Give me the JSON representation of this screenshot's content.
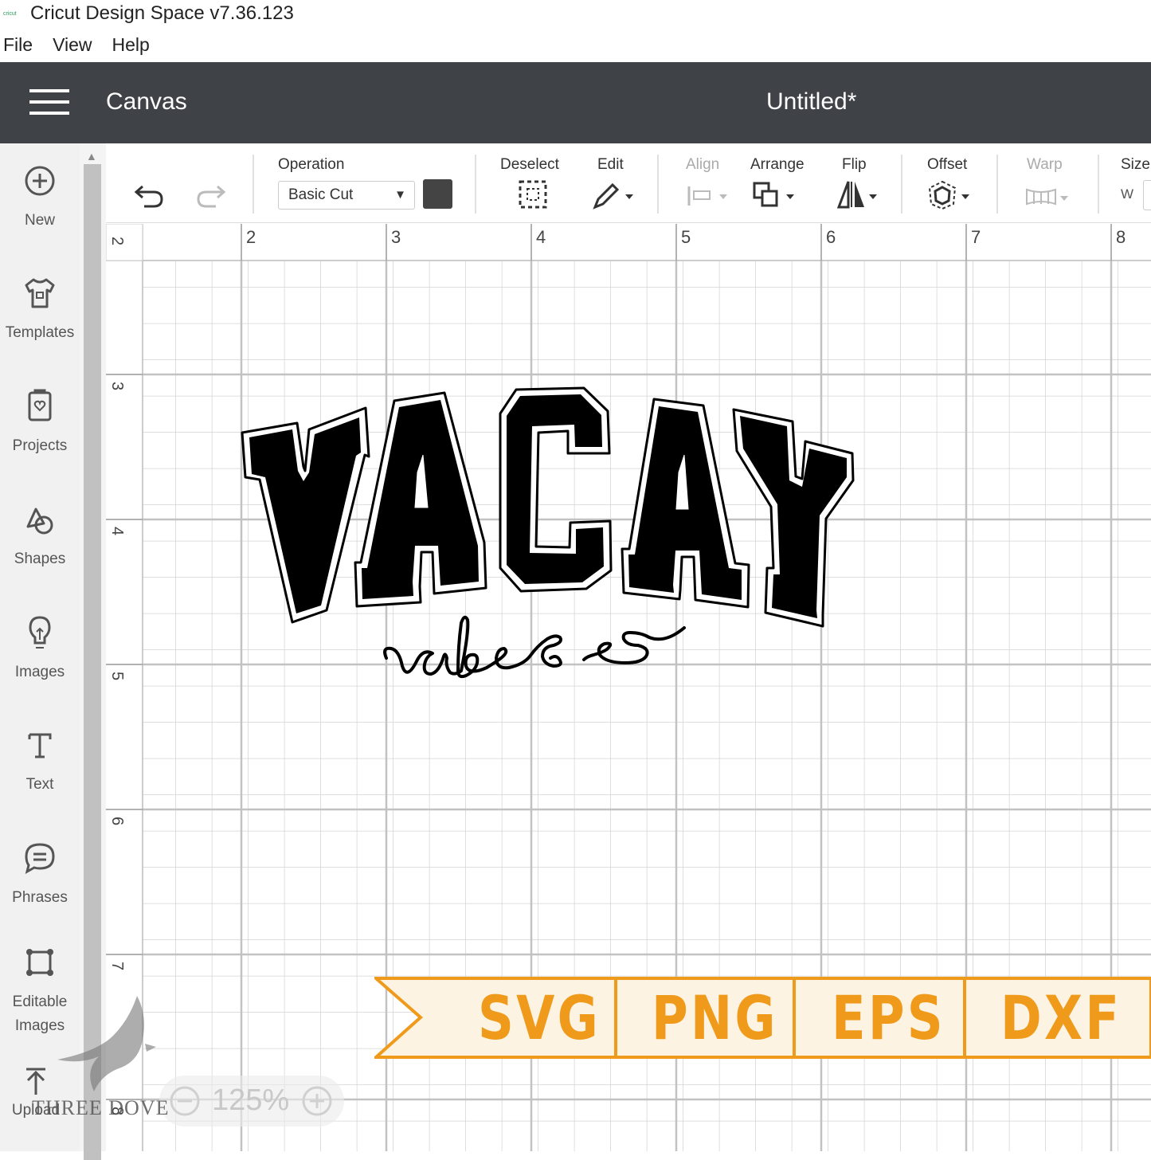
{
  "app": {
    "title": "Cricut Design Space  v7.36.123",
    "logo_text": "cricut"
  },
  "menu": [
    "File",
    "View",
    "Help"
  ],
  "header": {
    "section": "Canvas",
    "document": "Untitled*"
  },
  "sidebar": {
    "items": [
      {
        "label": "New",
        "icon": "plus-circle-icon"
      },
      {
        "label": "Templates",
        "icon": "tshirt-icon"
      },
      {
        "label": "Projects",
        "icon": "projects-icon"
      },
      {
        "label": "Shapes",
        "icon": "shapes-icon"
      },
      {
        "label": "Images",
        "icon": "lightbulb-icon"
      },
      {
        "label": "Text",
        "icon": "text-icon"
      },
      {
        "label": "Phrases",
        "icon": "speech-bubble-icon"
      },
      {
        "label": "Editable",
        "label2": "Images",
        "icon": "editable-images-icon"
      },
      {
        "label": "Upload",
        "icon": "upload-icon"
      }
    ]
  },
  "toolbar": {
    "operation_label": "Operation",
    "operation_value": "Basic Cut",
    "deselect": "Deselect",
    "edit": "Edit",
    "align": "Align",
    "arrange": "Arrange",
    "flip": "Flip",
    "offset": "Offset",
    "warp": "Warp",
    "size": "Size",
    "size_w": "W",
    "swatch_color": "#444444"
  },
  "rulers": {
    "horizontal": [
      "2",
      "3",
      "4",
      "5",
      "6",
      "7",
      "8"
    ],
    "vertical": [
      "2",
      "3",
      "4",
      "5",
      "6",
      "7",
      "8"
    ]
  },
  "design": {
    "headline": "VACAY",
    "script": "vibes"
  },
  "formats": [
    "SVG",
    "PNG",
    "EPS",
    "DXF"
  ],
  "zoom": "125%",
  "watermark": "THREE DOVE",
  "colors": {
    "header_bg": "#3f4247",
    "banner_orange": "#ef9a1a",
    "banner_fill": "#fdf3e2"
  }
}
